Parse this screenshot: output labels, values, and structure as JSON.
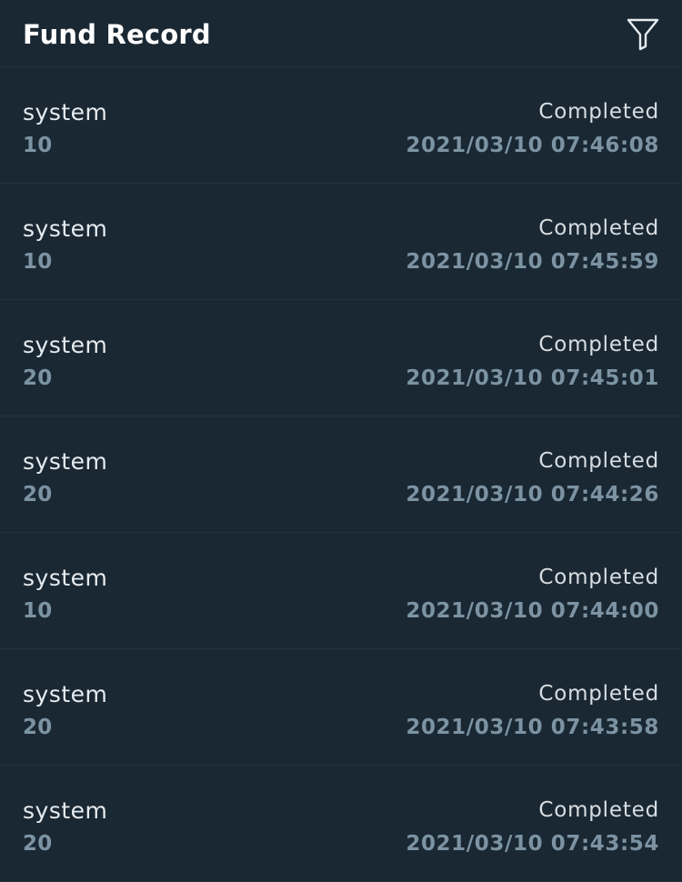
{
  "header": {
    "title": "Fund Record",
    "filter_icon": "filter-icon"
  },
  "records": [
    {
      "source": "system",
      "amount": "10",
      "status": "Completed",
      "time": "2021/03/10 07:46:08"
    },
    {
      "source": "system",
      "amount": "10",
      "status": "Completed",
      "time": "2021/03/10 07:45:59"
    },
    {
      "source": "system",
      "amount": "20",
      "status": "Completed",
      "time": "2021/03/10 07:45:01"
    },
    {
      "source": "system",
      "amount": "20",
      "status": "Completed",
      "time": "2021/03/10 07:44:26"
    },
    {
      "source": "system",
      "amount": "10",
      "status": "Completed",
      "time": "2021/03/10 07:44:00"
    },
    {
      "source": "system",
      "amount": "20",
      "status": "Completed",
      "time": "2021/03/10 07:43:58"
    },
    {
      "source": "system",
      "amount": "20",
      "status": "Completed",
      "time": "2021/03/10 07:43:54"
    }
  ],
  "colors": {
    "background": "#1a2833",
    "divider": "#23323d",
    "title": "#ffffff",
    "muted": "#7c93a3"
  }
}
